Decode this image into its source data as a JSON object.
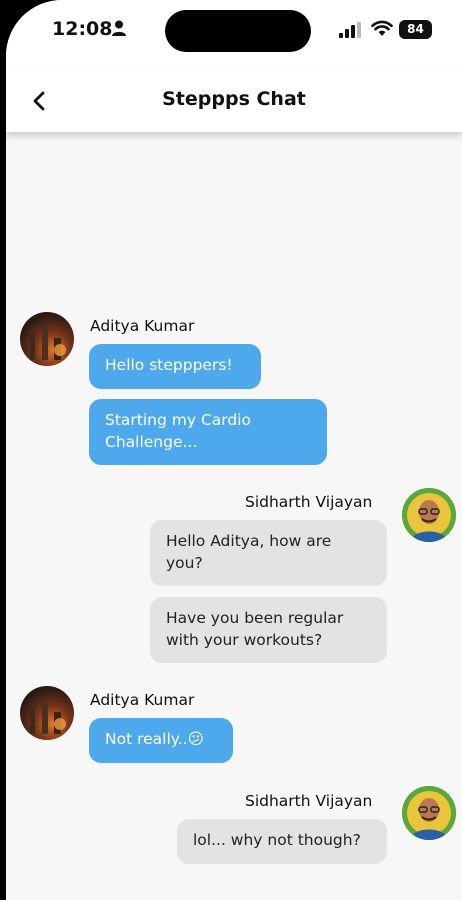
{
  "status": {
    "time": "12:08",
    "battery": "84"
  },
  "header": {
    "title": "Steppps Chat"
  },
  "messages": [
    {
      "sender": "Aditya Kumar",
      "texts": [
        "Hello stepppers!",
        "Starting my Cardio Challenge..."
      ]
    },
    {
      "sender": "Sidharth Vijayan",
      "texts": [
        "Hello Aditya, how are you?",
        "Have you been regular with your workouts?"
      ]
    },
    {
      "sender": "Aditya Kumar",
      "texts": [
        "Not really..😕"
      ]
    },
    {
      "sender": "Sidharth Vijayan",
      "texts": [
        "lol... why not though?"
      ]
    }
  ],
  "colors": {
    "outgoing_bubble": "#4ea8ec",
    "incoming_bubble": "#e3e3e3",
    "background": "#f7f7f7"
  },
  "icons": {
    "back": "chevron-left-icon",
    "person": "person-icon",
    "signal": "signal-icon",
    "wifi": "wifi-icon"
  }
}
